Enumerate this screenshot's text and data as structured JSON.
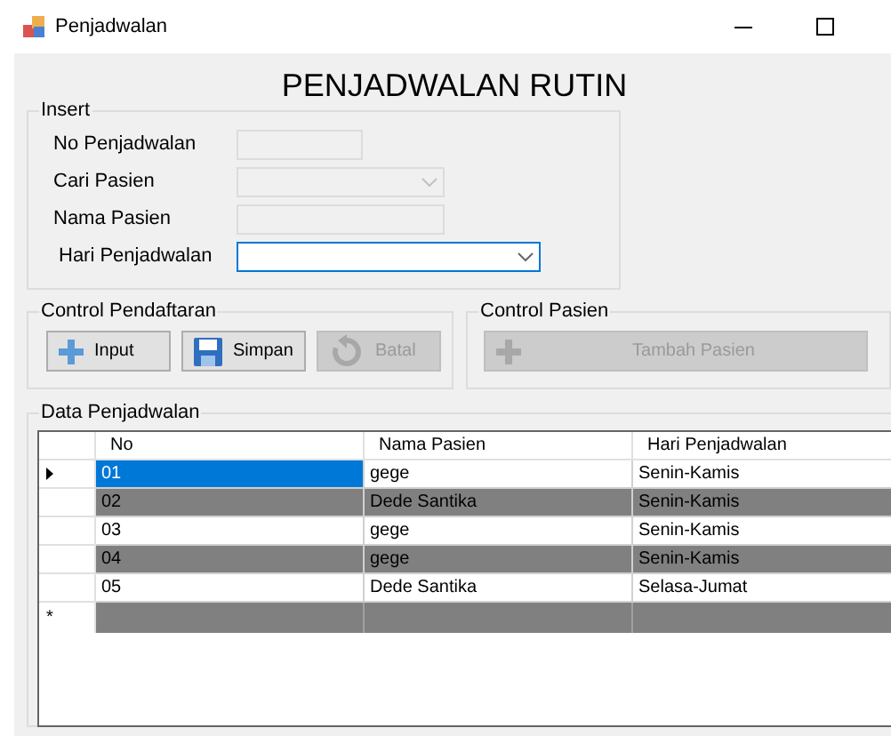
{
  "window": {
    "title": "Penjadwalan"
  },
  "heading": "PENJADWALAN RUTIN",
  "insert": {
    "title": "Insert",
    "fields": [
      {
        "kind": "text",
        "label": "No Penjadwalan",
        "disabled": true
      },
      {
        "kind": "combo",
        "label": "Cari Pasien",
        "disabled": true
      },
      {
        "kind": "text",
        "label": "Nama Pasien",
        "disabled": true
      },
      {
        "kind": "combo",
        "label": "Hari Penjadwalan",
        "disabled": false
      }
    ]
  },
  "control_pendaftaran": {
    "title": "Control Pendaftaran",
    "buttons": [
      {
        "kind": "plus",
        "label": "Input",
        "disabled": false
      },
      {
        "kind": "save",
        "label": "Simpan",
        "disabled": false
      },
      {
        "kind": "undo",
        "label": "Batal",
        "disabled": true
      }
    ]
  },
  "control_pasien": {
    "title": "Control Pasien",
    "buttons": [
      {
        "kind": "plus",
        "label": "Tambah Pasien",
        "disabled": true
      }
    ]
  },
  "data": {
    "title": "Data Penjadwalan",
    "new_row_marker": "*",
    "columns": [
      "No",
      "Nama Pasien",
      "Hari Penjadwalan"
    ],
    "rows": [
      {
        "cells": [
          "01",
          "gege",
          "Senin-Kamis"
        ],
        "selected": true
      },
      {
        "cells": [
          "02",
          "Dede Santika",
          "Senin-Kamis"
        ],
        "selected": false
      },
      {
        "cells": [
          "03",
          "gege",
          "Senin-Kamis"
        ],
        "selected": false
      },
      {
        "cells": [
          "04",
          "gege",
          "Senin-Kamis"
        ],
        "selected": false
      },
      {
        "cells": [
          "05",
          "Dede Santika",
          "Selasa-Jumat"
        ],
        "selected": false
      }
    ]
  }
}
